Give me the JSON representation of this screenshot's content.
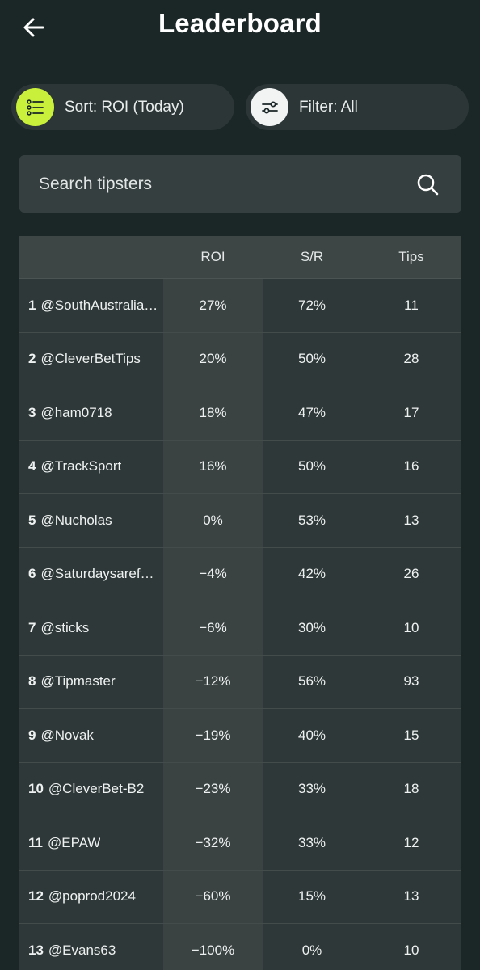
{
  "header": {
    "title": "Leaderboard"
  },
  "sort": {
    "label": "Sort: ROI (Today)"
  },
  "filter": {
    "label": "Filter: All"
  },
  "search": {
    "placeholder": "Search tipsters"
  },
  "table": {
    "columns": {
      "roi": "ROI",
      "sr": "S/R",
      "tips": "Tips"
    },
    "rows": [
      {
        "rank": "1",
        "handle": "@SouthAustralia…",
        "roi": "27%",
        "sr": "72%",
        "tips": "11"
      },
      {
        "rank": "2",
        "handle": "@CleverBetTips",
        "roi": "20%",
        "sr": "50%",
        "tips": "28"
      },
      {
        "rank": "3",
        "handle": "@ham0718",
        "roi": "18%",
        "sr": "47%",
        "tips": "17"
      },
      {
        "rank": "4",
        "handle": "@TrackSport",
        "roi": "16%",
        "sr": "50%",
        "tips": "16"
      },
      {
        "rank": "5",
        "handle": "@Nucholas",
        "roi": "0%",
        "sr": "53%",
        "tips": "13"
      },
      {
        "rank": "6",
        "handle": "@Saturdaysaref…",
        "roi": "−4%",
        "sr": "42%",
        "tips": "26"
      },
      {
        "rank": "7",
        "handle": "@sticks",
        "roi": "−6%",
        "sr": "30%",
        "tips": "10"
      },
      {
        "rank": "8",
        "handle": "@Tipmaster",
        "roi": "−12%",
        "sr": "56%",
        "tips": "93"
      },
      {
        "rank": "9",
        "handle": "@Novak",
        "roi": "−19%",
        "sr": "40%",
        "tips": "15"
      },
      {
        "rank": "10",
        "handle": "@CleverBet-B2",
        "roi": "−23%",
        "sr": "33%",
        "tips": "18"
      },
      {
        "rank": "11",
        "handle": "@EPAW",
        "roi": "−32%",
        "sr": "33%",
        "tips": "12"
      },
      {
        "rank": "12",
        "handle": "@poprod2024",
        "roi": "−60%",
        "sr": "15%",
        "tips": "13"
      },
      {
        "rank": "13",
        "handle": "@Evans63",
        "roi": "−100%",
        "sr": "0%",
        "tips": "10"
      }
    ]
  },
  "icons": {
    "back": "arrow-left-icon",
    "sort": "list-icon",
    "filter": "sliders-icon",
    "search": "search-icon"
  },
  "colors": {
    "background": "#1b2626",
    "accent": "#c9f03a",
    "surface": "#2c3636"
  }
}
